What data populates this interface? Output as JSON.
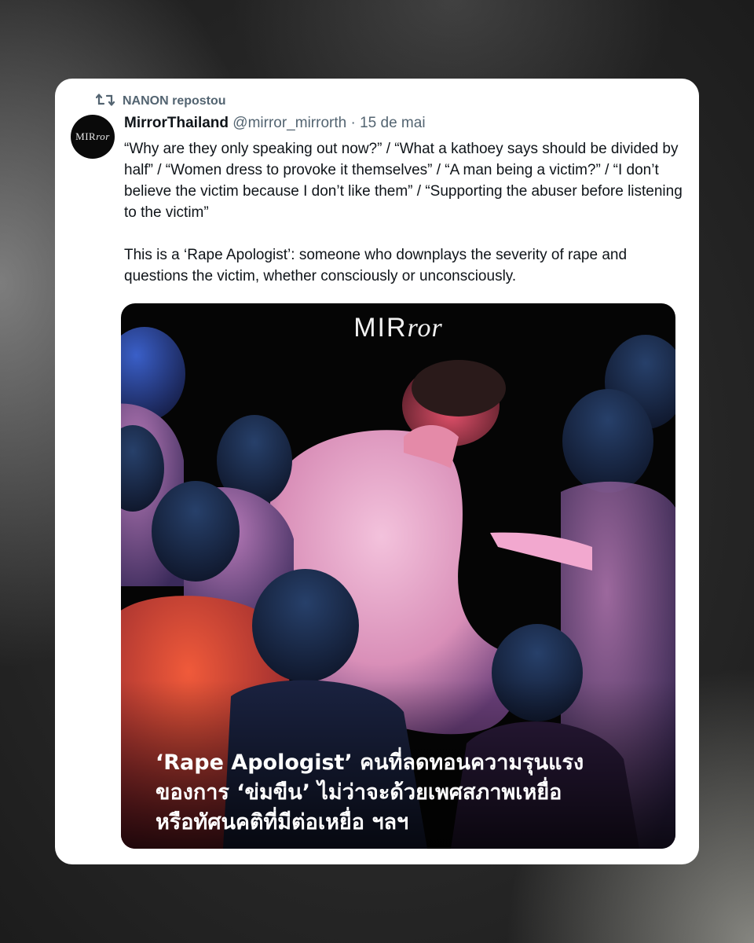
{
  "repost": {
    "label": "NANON repostou",
    "icon": "repost-icon"
  },
  "author": {
    "avatar_text_plain": "MIR",
    "avatar_text_italic": "ror",
    "name": "MirrorThailand",
    "handle": "@mirror_mirrorth",
    "separator": " · ",
    "date": "15 de mai"
  },
  "tweet": {
    "paragraph1": "“Why are they only speaking out now?” / “What a kathoey says should be divided by half” / “Women dress to provoke it themselves” / “A man being a victim?” / “I don’t believe the victim because I don’t like them” / “Supporting the abuser before listening to the victim”",
    "paragraph2": "This is a ‘Rape Apologist’: someone who downplays the severity of rape and questions the victim, whether consciously or unconsciously."
  },
  "media": {
    "logo_plain": "MIR",
    "logo_italic": "ror",
    "caption_lines": [
      "‘Rape Apologist’ คนที่ลดทอนความรุนแรง",
      "ของการ ‘ข่มขืน’ ไม่ว่าจะด้วยเพศสภาพเหยื่อ",
      "หรือทัศนคติที่มีต่อเหยื่อ ฯลฯ"
    ]
  },
  "colors": {
    "card_bg": "#ffffff",
    "text_primary": "#0f1419",
    "text_secondary": "#536471",
    "media_bg": "#050505"
  }
}
